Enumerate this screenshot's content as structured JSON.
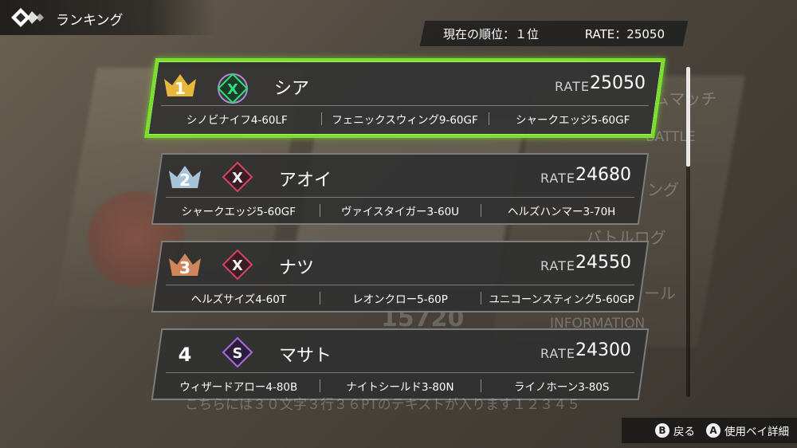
{
  "header": {
    "title": "ランキング",
    "icon": "crown-diamond-icon"
  },
  "status": {
    "rank_text": "現在の順位：１位",
    "rate_text": "RATE：25050"
  },
  "background": {
    "ghost_texts": [
      "ームマッチ",
      "BATTLE",
      "ング",
      "バトルログ",
      "ール",
      "INFORMATION",
      "15720"
    ]
  },
  "rankings": [
    {
      "rank": "1",
      "name": "シア",
      "rate_label": "RATE",
      "rate": "25050",
      "emblem": "x-green-emblem-icon",
      "parts": [
        "シノビナイフ4-60LF",
        "フェニックスウィング9-60GF",
        "シャークエッジ5-60GF"
      ],
      "rank_color": "#e8b83a",
      "emblem_color": "#2fe07a"
    },
    {
      "rank": "2",
      "name": "アオイ",
      "rate_label": "RATE",
      "rate": "24680",
      "emblem": "x-red-emblem-icon",
      "parts": [
        "シャークエッジ5-60GF",
        "ヴァイスタイガー3-60U",
        "ヘルズハンマー3-70H"
      ],
      "rank_color": "#a9c4d6",
      "emblem_color": "#d4455e"
    },
    {
      "rank": "3",
      "name": "ナツ",
      "rate_label": "RATE",
      "rate": "24550",
      "emblem": "x-red-emblem-icon",
      "parts": [
        "ヘルズサイズ4-60T",
        "レオンクロー5-60P",
        "ユニコーンスティング5-60GP"
      ],
      "rank_color": "#d0865a",
      "emblem_color": "#d4455e"
    },
    {
      "rank": "4",
      "name": "マサト",
      "rate_label": "RATE",
      "rate": "24300",
      "emblem": "s-purple-emblem-icon",
      "parts": [
        "ウィザードアロー4-80B",
        "ナイトシールド3-80N",
        "ライノホーン3-80S"
      ],
      "rank_color": "#ffffff",
      "emblem_color": "#a86be0"
    }
  ],
  "footer": {
    "ghost_text": "こちらには３０文字３行３６PTのテキストが入ります１２３４５",
    "back_key": "B",
    "back_label": "戻る",
    "detail_key": "A",
    "detail_label": "使用ベイ詳細"
  }
}
